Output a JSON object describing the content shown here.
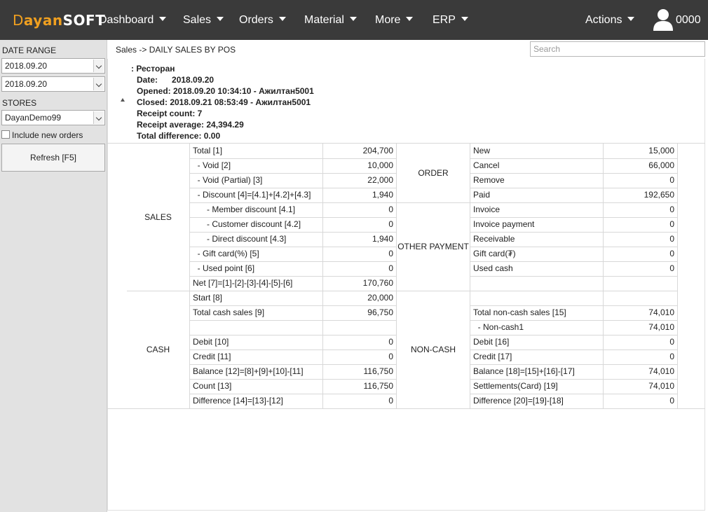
{
  "app": {
    "logo": {
      "part1": "D",
      "part2": "ayan",
      "part3": "SOFT"
    },
    "nav": [
      {
        "label": "Dashboard"
      },
      {
        "label": "Sales"
      },
      {
        "label": "Orders"
      },
      {
        "label": "Material"
      },
      {
        "label": "More"
      },
      {
        "label": "ERP"
      }
    ],
    "actions_label": "Actions",
    "user": "0000"
  },
  "sidebar": {
    "date_range_label": "DATE RANGE",
    "date_from": "2018.09.20",
    "date_to": "2018.09.20",
    "stores_label": "STORES",
    "store": "DayanDemo99",
    "include_new_orders": "Include new orders",
    "refresh_label": "Refresh [F5]"
  },
  "header": {
    "breadcrumb": "Sales -> DAILY SALES BY POS",
    "search_placeholder": "Search"
  },
  "summary": {
    "title": ": Ресторан",
    "date_label": "Date:",
    "date": "2018.09.20",
    "opened": "Opened: 2018.09.20 10:34:10 - Ажилтан5001",
    "closed": "Closed:  2018.09.21 08:53:49 - Ажилтан5001",
    "receipt_count": "Receipt count: 7",
    "receipt_average": "Receipt average: 24,394.29",
    "total_difference": "Total difference: 0.00"
  },
  "report": {
    "left_groups": [
      {
        "name": "SALES",
        "rows": [
          {
            "label": "Total [1]",
            "value": "204,700"
          },
          {
            "label": " - Void [2]",
            "value": "10,000"
          },
          {
            "label": " - Void (Partial) [3]",
            "value": "22,000"
          },
          {
            "label": " - Discount [4]=[4.1]+[4.2]+[4.3]",
            "value": "1,940"
          },
          {
            "label": "   - Member discount [4.1]",
            "value": "0"
          },
          {
            "label": "   - Customer discount [4.2]",
            "value": "0"
          },
          {
            "label": "   - Direct discount [4.3]",
            "value": "1,940"
          },
          {
            "label": " - Gift card(%) [5]",
            "value": "0"
          },
          {
            "label": " - Used point [6]",
            "value": "0"
          },
          {
            "label": "Net [7]=[1]-[2]-[3]-[4]-[5]-[6]",
            "value": "170,760"
          }
        ]
      },
      {
        "name": "CASH",
        "rows": [
          {
            "label": "Start [8]",
            "value": "20,000"
          },
          {
            "label": "Total cash sales [9]",
            "value": "96,750"
          },
          {
            "label": "",
            "value": ""
          },
          {
            "label": "Debit [10]",
            "value": "0"
          },
          {
            "label": "Credit [11]",
            "value": "0"
          },
          {
            "label": "Balance [12]=[8]+[9]+[10]-[11]",
            "value": "116,750"
          },
          {
            "label": "Count [13]",
            "value": "116,750"
          },
          {
            "label": "Difference [14]=[13]-[12]",
            "value": "0"
          }
        ]
      }
    ],
    "right_groups": [
      {
        "name": "ORDER",
        "rows": [
          {
            "label": "New",
            "value": "15,000"
          },
          {
            "label": "Cancel",
            "value": "66,000"
          },
          {
            "label": "Remove",
            "value": "0"
          },
          {
            "label": "Paid",
            "value": "192,650"
          }
        ]
      },
      {
        "name": "OTHER PAYMENT",
        "rows": [
          {
            "label": "Invoice",
            "value": "0"
          },
          {
            "label": "Invoice payment",
            "value": "0"
          },
          {
            "label": "Receivable",
            "value": "0"
          },
          {
            "label": "Gift card(₮)",
            "value": "0"
          },
          {
            "label": "Used cash",
            "value": "0"
          },
          {
            "label": "",
            "value": ""
          }
        ]
      },
      {
        "name": "NON-CASH",
        "rows": [
          {
            "label": "",
            "value": ""
          },
          {
            "label": "Total non-cash sales [15]",
            "value": "74,010"
          },
          {
            "label": " - Non-cash1",
            "value": "74,010"
          },
          {
            "label": "Debit [16]",
            "value": "0"
          },
          {
            "label": "Credit [17]",
            "value": "0"
          },
          {
            "label": "Balance [18]=[15]+[16]-[17]",
            "value": "74,010"
          },
          {
            "label": "Settlements(Card) [19]",
            "value": "74,010"
          },
          {
            "label": "Difference [20]=[19]-[18]",
            "value": "0"
          }
        ]
      }
    ]
  },
  "colors": {
    "topbar": "#3a3a3a",
    "logo_accent": "#f0a020",
    "sidebar": "#e2e2e2"
  }
}
